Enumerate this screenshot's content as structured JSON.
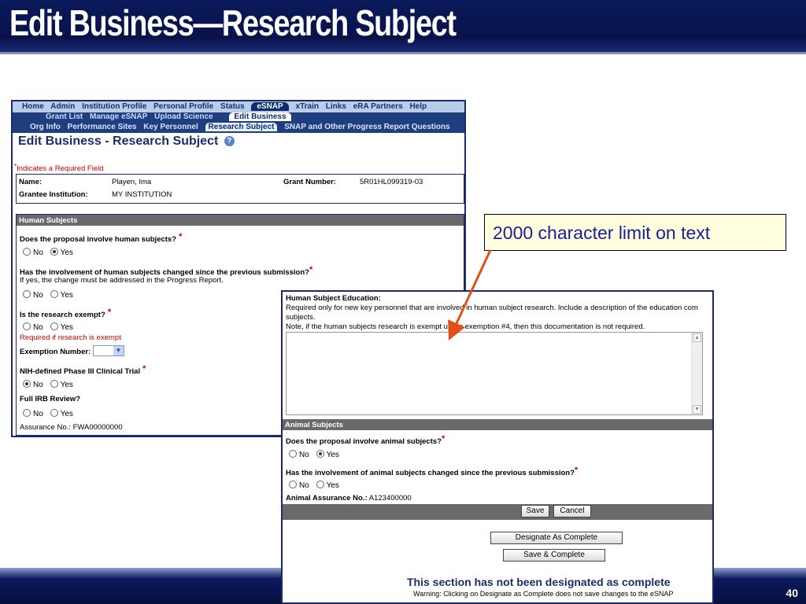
{
  "slide": {
    "title": "Edit Business—Research Subject",
    "page_number": "40"
  },
  "callout": {
    "text": "2000 character limit on text"
  },
  "nav": {
    "top_items": [
      "Home",
      "Admin",
      "Institution Profile",
      "Personal Profile",
      "Status"
    ],
    "active_top": "eSNAP",
    "top_items_after": [
      "xTrain",
      "Links",
      "eRA Partners",
      "Help"
    ],
    "sub1_items": [
      "Grant List",
      "Manage eSNAP",
      "Upload Science"
    ],
    "sub1_active": "Edit Business",
    "sub2_items": [
      "Org Info",
      "Performance Sites",
      "Key Personnel"
    ],
    "sub2_active": "Research Subject",
    "sub2_after": "SNAP and Other Progress Report Questions"
  },
  "page": {
    "title": "Edit Business - Research Subject",
    "required_note": "Indicates a Required Field"
  },
  "grant_info": {
    "name_label": "Name:",
    "name_value": "Playen, Ima",
    "grant_label": "Grant Number:",
    "grant_value": "5R01HL099319-03",
    "inst_label": "Grantee Institution:",
    "inst_value": "MY INSTITUTION"
  },
  "human_subjects": {
    "header": "Human Subjects",
    "q1": "Does the proposal involve human subjects?",
    "q1_selected": "Yes",
    "q2": "Has the involvement of human subjects changed since the previous submission?",
    "q2_note": "If yes, the change must be addressed in the Progress Report.",
    "q3": "Is the research exempt?",
    "q3_note": "Required if research is exempt",
    "exemption_label": "Exemption Number:",
    "q4": "NIH-defined Phase III Clinical Trial",
    "q4_selected": "No",
    "q5": "Full IRB Review?",
    "assurance": "Assurance No.: FWA00000000",
    "no_label": "No",
    "yes_label": "Yes"
  },
  "shot2": {
    "edu_title": "Human Subject Education:",
    "edu_line1": "Required only for new key personnel that are involved in human subject research. Include a description of the education com",
    "edu_line2": "subjects.",
    "edu_line3": "Note, if the human subjects research is exempt under exemption #4, then this documentation is not required.",
    "animal_header": "Animal Subjects",
    "aq1": "Does the proposal involve animal subjects?",
    "aq1_selected": "Yes",
    "aq2": "Has the involvement of animal subjects changed since the previous submission?",
    "animal_assurance_label": "Animal Assurance No.:",
    "animal_assurance_value": "A123400000",
    "save_label": "Save",
    "cancel_label": "Cancel",
    "designate_label": "Designate As Complete",
    "save_complete_label": "Save & Complete",
    "status_text": "This section has not been designated as complete",
    "warning_text": "Warning: Clicking on Designate as Complete does not save changes to the eSNAP",
    "no_label": "No",
    "yes_label": "Yes"
  },
  "colors": {
    "title_bar": "#0a1a5c",
    "callout_text": "#1a2090",
    "arrow": "#e0501a",
    "required": "#cc0000"
  }
}
